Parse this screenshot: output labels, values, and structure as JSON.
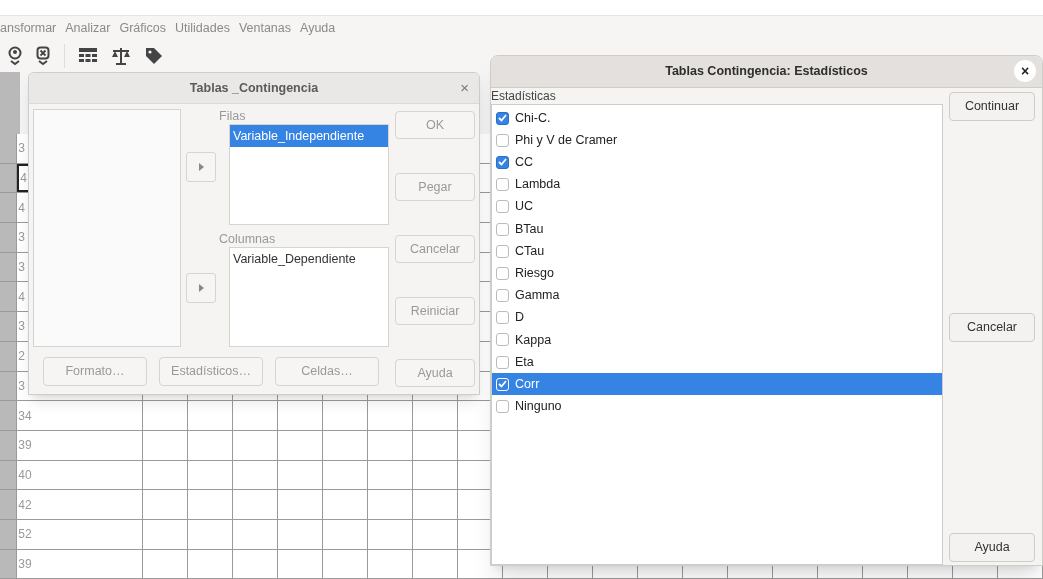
{
  "menu_bar": [
    "ansformar",
    "Analizar",
    "Gráficos",
    "Utilidades",
    "Ventanas",
    "Ayuda"
  ],
  "grid": {
    "rows": [
      {
        "value": "3",
        "selected": false
      },
      {
        "value": "4",
        "selected": true
      },
      {
        "value": "4",
        "selected": false
      },
      {
        "value": "3",
        "selected": false
      },
      {
        "value": "3",
        "selected": false
      },
      {
        "value": "4",
        "selected": false
      },
      {
        "value": "3",
        "selected": false
      },
      {
        "value": "2",
        "selected": false
      },
      {
        "value": "3",
        "selected": false
      },
      {
        "value": "34",
        "selected": false
      },
      {
        "value": "39",
        "selected": false
      },
      {
        "value": "40",
        "selected": false
      },
      {
        "value": "42",
        "selected": false
      },
      {
        "value": "52",
        "selected": false
      },
      {
        "value": "39",
        "selected": false
      }
    ]
  },
  "crosstabs_dialog": {
    "title": "Tablas _Contingencia",
    "close": "×",
    "rows_label": "Filas",
    "rows_vars": [
      {
        "label": "Variable_Independiente",
        "selected": true
      }
    ],
    "columns_label": "Columnas",
    "columns_vars": [
      {
        "label": "Variable_Dependiente",
        "selected": false
      }
    ],
    "side_buttons": [
      "OK",
      "Pegar",
      "Cancelar",
      "Reiniciar",
      "Ayuda"
    ],
    "bottom_buttons": [
      "Formato…",
      "Estadísticos…",
      "Celdas…"
    ]
  },
  "statistics_dialog": {
    "title": "Tablas Contingencia: Estadísticos",
    "close": "×",
    "group_label": "Estadísticas",
    "items": [
      {
        "label": "Chi-C.",
        "checked": true,
        "selected": false
      },
      {
        "label": "Phi y V de Cramer",
        "checked": false,
        "selected": false
      },
      {
        "label": "CC",
        "checked": true,
        "selected": false
      },
      {
        "label": "Lambda",
        "checked": false,
        "selected": false
      },
      {
        "label": "UC",
        "checked": false,
        "selected": false
      },
      {
        "label": "BTau",
        "checked": false,
        "selected": false
      },
      {
        "label": "CTau",
        "checked": false,
        "selected": false
      },
      {
        "label": "Riesgo",
        "checked": false,
        "selected": false
      },
      {
        "label": "Gamma",
        "checked": false,
        "selected": false
      },
      {
        "label": "D",
        "checked": false,
        "selected": false
      },
      {
        "label": "Kappa",
        "checked": false,
        "selected": false
      },
      {
        "label": "Eta",
        "checked": false,
        "selected": false
      },
      {
        "label": "Corr",
        "checked": true,
        "selected": true
      },
      {
        "label": "Ninguno",
        "checked": false,
        "selected": false
      }
    ],
    "buttons": [
      "Continuar",
      "Cancelar",
      "Ayuda"
    ]
  }
}
